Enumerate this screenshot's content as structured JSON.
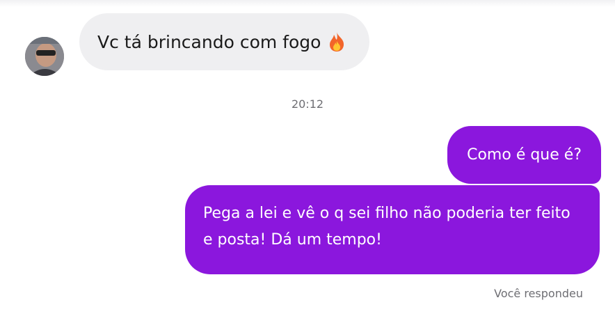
{
  "conversation": {
    "incoming": {
      "text": "Vc tá brincando com fogo",
      "emoji_icon": "fire-icon"
    },
    "timestamp": "20:12",
    "outgoing": [
      {
        "text": "Como é que é?"
      },
      {
        "text": "Pega a lei e vê o q sei filho não poderia ter feito e posta! Dá um tempo!"
      }
    ],
    "footer": "Você respondeu"
  },
  "colors": {
    "outgoing_bubble": "#8b17dd",
    "incoming_bubble": "#efeff1",
    "muted_text": "#6e6e73"
  }
}
